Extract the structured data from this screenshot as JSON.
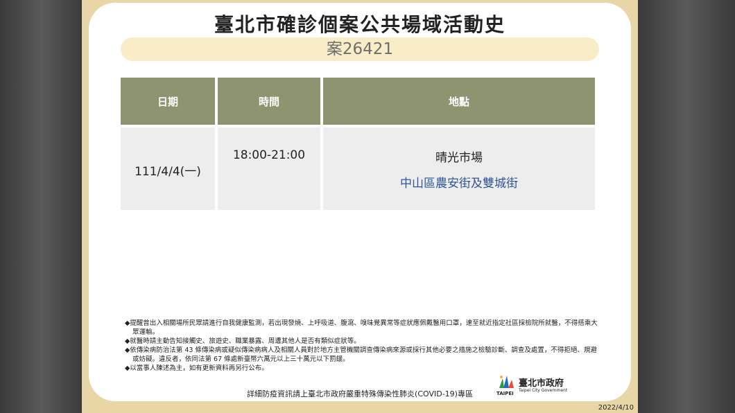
{
  "header": {
    "title": "臺北市確診個案公共場域活動史",
    "case_number": "案26421"
  },
  "table": {
    "headers": [
      "日期",
      "時間",
      "地點"
    ],
    "rows": [
      {
        "date": "111/4/4(一)",
        "time": "18:00-21:00",
        "place_name": "晴光市場",
        "place_address": "中山區農安街及雙城街"
      }
    ]
  },
  "notes": [
    "◆提醒曾出入相關場所民眾請進行自我健康監測，若出現發燒、上呼吸道、腹瀉、嗅味覺異常等症狀應佩戴醫用口罩，速至就近指定社區採檢院所就醫，不得搭乘大眾運輸。",
    "◆就醫時請主動告知接觸史、旅遊史、職業暴露、周遭其他人是否有類似症狀等。",
    "◆依傳染病防治法第 43 條傳染病或疑似傳染病病人及相關人員對於地方主管機關調查傳染病來源或採行其他必要之措施之檢驗診斷、調查及處置，不得拒絕、規避或妨礙。違反者，依同法第 67 條處新臺幣六萬元以上三十萬元以下罰鍰。",
    "◆以當事人陳述為主，如有更新資料再另行公布。"
  ],
  "footer": {
    "link_text": "詳細防疫資訊請上臺北市政府嚴重特殊傳染性肺炎(COVID-19)專區",
    "logo_name": "臺北市政府",
    "logo_en": "Taipei City Government",
    "logo_taipei": "TAIPEI",
    "date": "2022/4/10"
  },
  "colors": {
    "frame": "#e9d6a6",
    "header_cell": "#8f9470",
    "body_cell": "#ededed",
    "address": "#2f5597",
    "pill": "#f8edc6"
  }
}
